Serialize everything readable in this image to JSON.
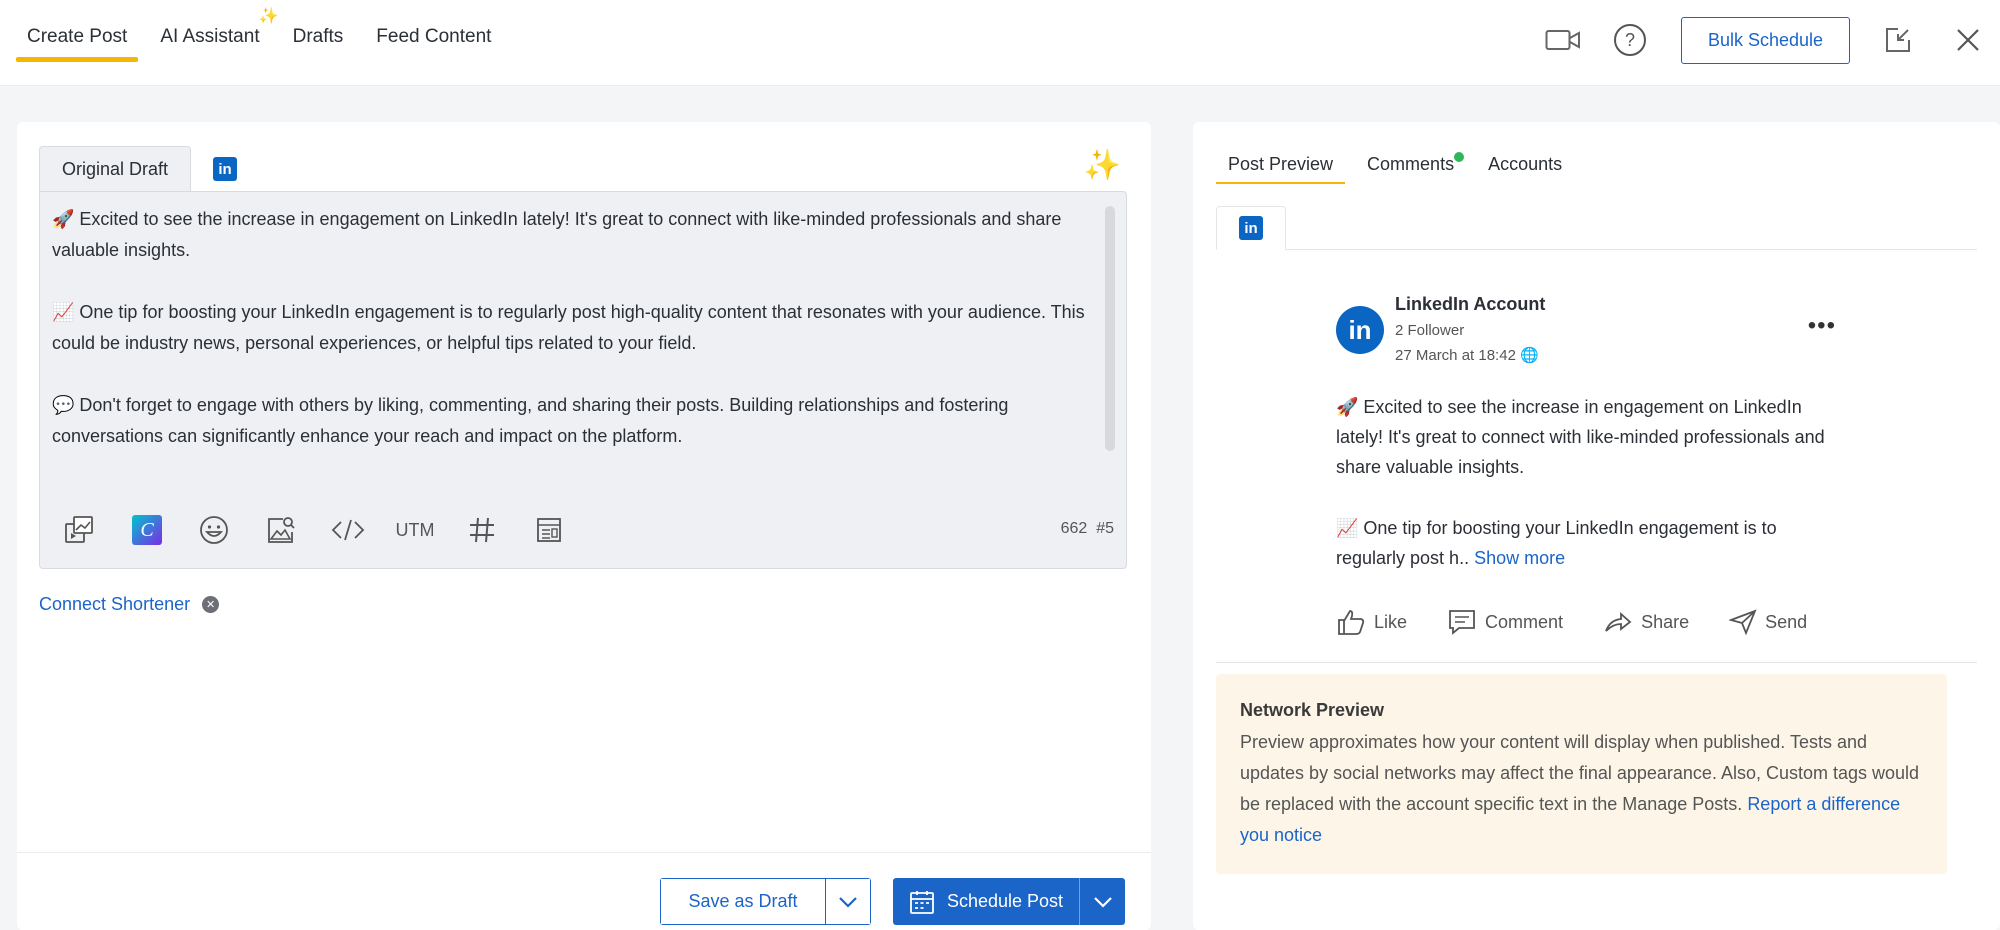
{
  "top_tabs": {
    "create_post": "Create Post",
    "ai_assistant": "AI Assistant",
    "drafts": "Drafts",
    "feed_content": "Feed Content"
  },
  "header": {
    "bulk_schedule": "Bulk Schedule"
  },
  "editor": {
    "tab_original": "Original Draft",
    "paragraphs": [
      "🚀 Excited to see the increase in engagement on LinkedIn lately! It's great to connect with like-minded professionals and share valuable insights.",
      "📈 One tip for boosting your LinkedIn engagement is to regularly post high-quality content that resonates with your audience. This could be industry news, personal experiences, or helpful tips related to your field.",
      "💬 Don't forget to engage with others by liking, commenting, and sharing their posts. Building relationships and fostering conversations can significantly enhance your reach and impact on the platform."
    ],
    "toolbar": {
      "utm": "UTM",
      "canva": "C"
    },
    "char_count": "662",
    "hashtag_count": "#5"
  },
  "connect_shortener": "Connect Shortener",
  "footer": {
    "save_draft": "Save as Draft",
    "schedule_post": "Schedule Post"
  },
  "preview": {
    "tabs": {
      "post_preview": "Post Preview",
      "comments": "Comments",
      "accounts": "Accounts"
    },
    "account_name": "LinkedIn Account",
    "followers": "2 Follower",
    "timestamp": "27 March at 18:42",
    "body_p1": "🚀 Excited to see the increase in engagement on LinkedIn lately! It's great to connect with like-minded professionals and share valuable insights.",
    "body_p2": "📈 One tip for boosting your LinkedIn engagement is to regularly post h..",
    "show_more": "Show more",
    "actions": {
      "like": "Like",
      "comment": "Comment",
      "share": "Share",
      "send": "Send"
    }
  },
  "network_preview": {
    "title": "Network Preview",
    "text": "Preview approximates how your content will display when published. Tests and updates by social networks may affect the final appearance. Also, Custom tags would be replaced with the account specific text in the Manage Posts.",
    "link": "Report a difference you notice"
  },
  "colors": {
    "accent_yellow": "#f5b500",
    "brand_blue": "#1b64c8",
    "linkedin_blue": "#0a66c2",
    "notice_bg": "#fdf6e8"
  },
  "icons": {
    "video": "video-camera-icon",
    "help": "question-circle-icon",
    "minimize": "minimize-window-icon",
    "close": "close-icon"
  }
}
